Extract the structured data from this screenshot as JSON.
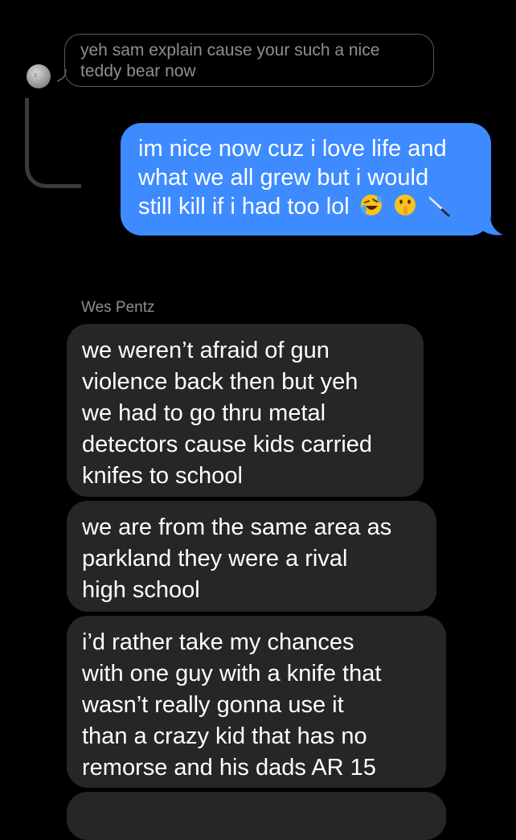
{
  "quoted_message": {
    "lines": [
      "yeh sam explain cause your such a nice",
      "teddy bear now"
    ]
  },
  "sent_message": {
    "lines": [
      "im nice now cuz i love life and",
      "what we all grew but i would",
      "still kill if i had too lol"
    ],
    "emojis": [
      "rolling-on-floor-laughing-emoji",
      "shushing-face-emoji",
      "knife-emoji"
    ]
  },
  "sender_name": "Wes Pentz",
  "received_messages": [
    {
      "lines": [
        "we weren’t  afraid of gun",
        "violence back then but yeh",
        "we had to go thru metal",
        "detectors cause kids carried",
        "knifes to school"
      ]
    },
    {
      "lines": [
        "we are from the same area as",
        "parkland they were a rival",
        "high school"
      ]
    },
    {
      "lines": [
        "i’d rather take my chances",
        "with one guy with a knife that",
        "wasn’t really gonna use it",
        "than a crazy kid that has no",
        "remorse and his dads AR 15"
      ]
    }
  ],
  "colors": {
    "background": "#000000",
    "sent_bubble": "#3e8bff",
    "received_bubble": "#262628",
    "secondary_text": "#8e8e93"
  }
}
